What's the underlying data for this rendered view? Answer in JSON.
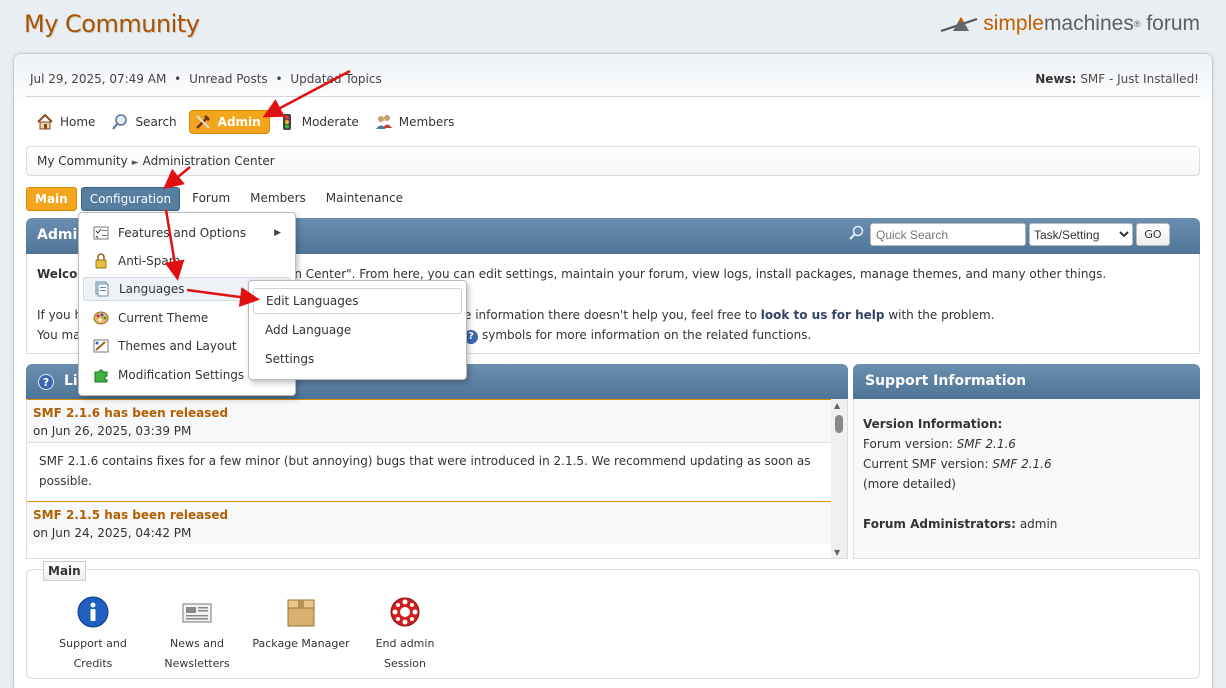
{
  "site": {
    "title": "My Community",
    "logo_part1": "simple",
    "logo_part2": "machines",
    "logo_part3": "forum"
  },
  "upper": {
    "datetime": "Jul 29, 2025, 07:49 AM",
    "bullet": "•",
    "unread_posts": "Unread Posts",
    "updated_topics": "Updated Topics",
    "news_label": "News:",
    "news_text": "SMF - Just Installed!"
  },
  "menu": {
    "home": "Home",
    "search": "Search",
    "admin": "Admin",
    "moderate": "Moderate",
    "members": "Members"
  },
  "breadcrumb": {
    "item1": "My Community",
    "separator": "►",
    "item2": "Administration Center"
  },
  "tabs": {
    "main": "Main",
    "configuration": "Configuration",
    "forum": "Forum",
    "members": "Members",
    "maintenance": "Maintenance"
  },
  "admin_bar": {
    "title_visible": "Admi",
    "quick_search_placeholder": "Quick Search",
    "select_value": "Task/Setting",
    "go_label": "GO"
  },
  "welcome": {
    "line1_start": "Welco",
    "line1_rest": "on Center\". From here, you can edit settings, maintain your forum, view logs, install packages, manage themes, and many other things.",
    "line2_start": "If you h",
    "line2_rest_pre": "e information there doesn't help you, feel free to ",
    "line2_link": "look to us for help",
    "line2_rest_post": " with the problem.",
    "line3_start": "You ma",
    "line3_icon": "?",
    "line3_rest": "symbols for more information on the related functions."
  },
  "live_panel": {
    "icon": "?",
    "title_visible": "Li",
    "items": [
      {
        "title": "SMF 2.1.6 has been released",
        "date": "on Jun 26, 2025, 03:39 PM",
        "body": "SMF 2.1.6 contains fixes for a few minor (but annoying) bugs that were introduced in 2.1.5. We recommend updating as soon as possible."
      },
      {
        "title": "SMF 2.1.5 has been released",
        "date": "on Jun 24, 2025, 04:42 PM"
      }
    ]
  },
  "support": {
    "title": "Support Information",
    "version_info": "Version Information:",
    "forum_version_label": "Forum version:",
    "forum_version": "SMF 2.1.6",
    "current_version_label": "Current SMF version:",
    "current_version": "SMF 2.1.6",
    "more_detailed": "(more detailed)",
    "admins_label": "Forum Administrators:",
    "admins": "admin"
  },
  "main_section": {
    "label": "Main",
    "items": [
      {
        "line1": "Support and",
        "line2": "Credits",
        "icon": "info-icon"
      },
      {
        "line1": "News and",
        "line2": "Newsletters",
        "icon": "newspaper-icon"
      },
      {
        "line1": "Package Manager",
        "line2": "",
        "icon": "package-icon"
      },
      {
        "line1": "End admin Session",
        "line2": "",
        "icon": "lifebuoy-icon"
      }
    ]
  },
  "config_dropdown": {
    "items": [
      {
        "label": "Features and Options",
        "icon": "checklist-icon",
        "has_submenu": true
      },
      {
        "label": "Anti-Spam",
        "icon": "lock-icon"
      },
      {
        "label": "Languages",
        "icon": "languages-icon"
      },
      {
        "label": "Current Theme",
        "icon": "palette-icon"
      },
      {
        "label": "Themes and Layout",
        "icon": "themes-icon"
      },
      {
        "label": "Modification Settings",
        "icon": "puzzle-icon"
      }
    ]
  },
  "languages_submenu": {
    "items": [
      {
        "label": "Edit Languages"
      },
      {
        "label": "Add Language"
      },
      {
        "label": "Settings"
      }
    ]
  },
  "colors": {
    "accent_orange": "#f4a51e",
    "header_blue": "#557ea0",
    "news_title": "#b35e00",
    "annotation_red": "#e01010"
  }
}
